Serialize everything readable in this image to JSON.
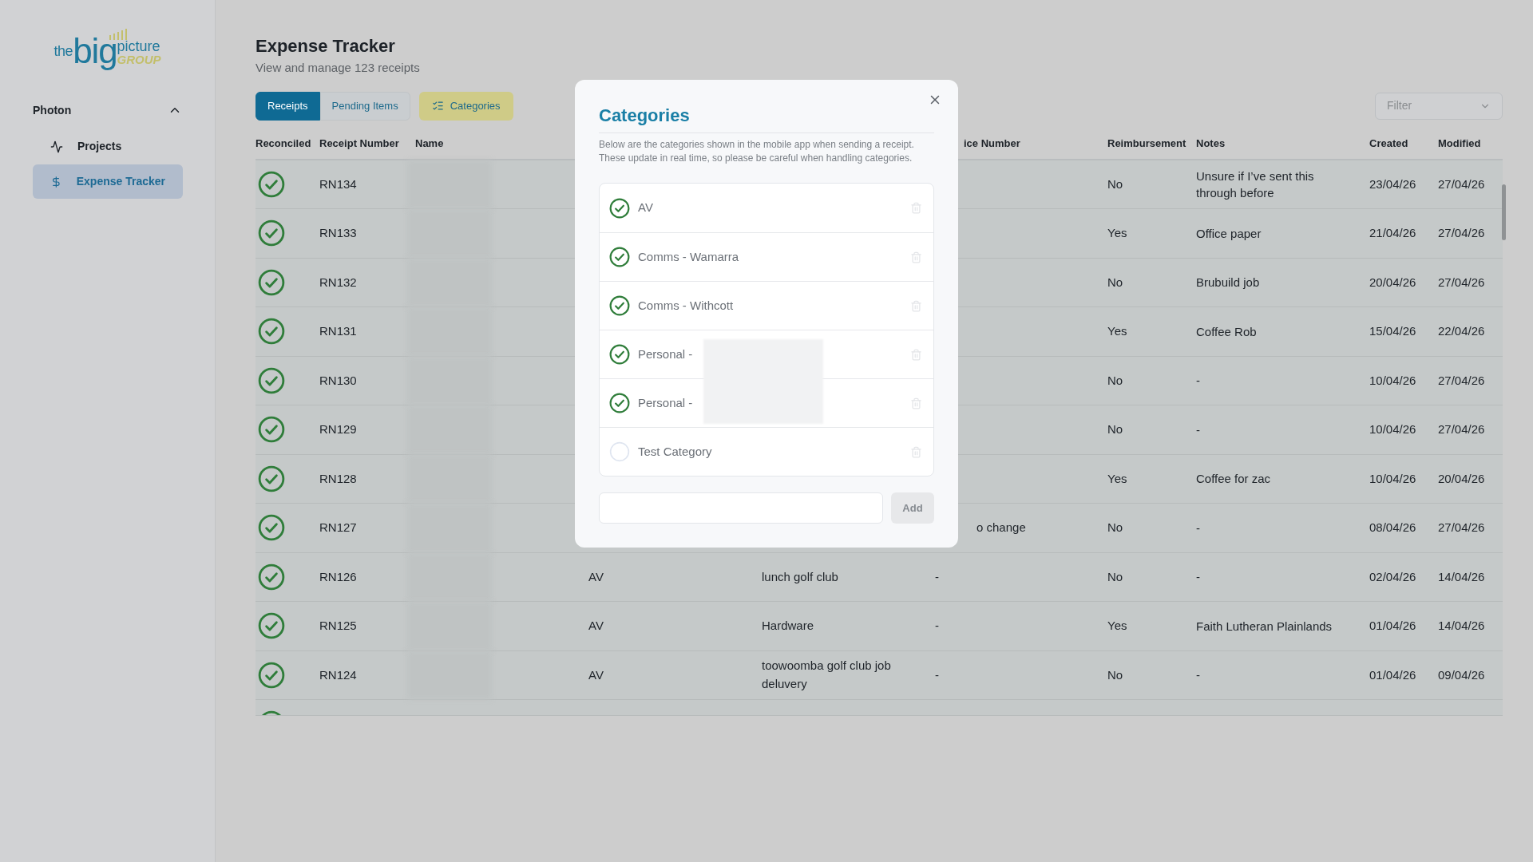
{
  "logo": {
    "word_1": "the",
    "word_2": "big",
    "word_3": "picture",
    "word_4": "GROUP"
  },
  "sidebar": {
    "section": {
      "label": "Photon",
      "expanded": true
    },
    "items": [
      {
        "label": "Projects",
        "kind": "activity",
        "selected": false
      },
      {
        "label": "Expense Tracker",
        "kind": "dollar",
        "selected": true
      }
    ]
  },
  "header": {
    "title": "Expense Tracker",
    "subtitle": "View and manage 123 receipts"
  },
  "tabs": [
    {
      "label": "Receipts",
      "selected": true
    },
    {
      "label": "Pending Items",
      "selected": false
    }
  ],
  "categories_button": {
    "label": "Categories",
    "active": true
  },
  "filter": {
    "placeholder": "Filter"
  },
  "table": {
    "columns": [
      "Reconciled",
      "Receipt Number",
      "Name",
      "ice Number",
      "Reimbursement",
      "Notes",
      "Created",
      "Modified"
    ],
    "rows": [
      {
        "reconciled": true,
        "receipt_number": "RN134",
        "reimbursement": "No",
        "notes": "Unsure if I’ve sent this through before",
        "created": "23/04/26",
        "modified": "27/04/26"
      },
      {
        "reconciled": true,
        "receipt_number": "RN133",
        "reimbursement": "Yes",
        "notes": "Office paper",
        "created": "21/04/26",
        "modified": "27/04/26"
      },
      {
        "reconciled": true,
        "receipt_number": "RN132",
        "reimbursement": "No",
        "notes": "Brubuild job",
        "created": "20/04/26",
        "modified": "27/04/26"
      },
      {
        "reconciled": true,
        "receipt_number": "RN131",
        "reimbursement": "Yes",
        "notes": "Coffee Rob",
        "created": "15/04/26",
        "modified": "22/04/26"
      },
      {
        "reconciled": true,
        "receipt_number": "RN130",
        "reimbursement": "No",
        "notes": "-",
        "created": "10/04/26",
        "modified": "27/04/26"
      },
      {
        "reconciled": true,
        "receipt_number": "RN129",
        "reimbursement": "No",
        "notes": "-",
        "created": "10/04/26",
        "modified": "27/04/26"
      },
      {
        "reconciled": true,
        "receipt_number": "RN128",
        "reimbursement": "Yes",
        "notes": "Coffee for zac",
        "created": "10/04/26",
        "modified": "20/04/26"
      },
      {
        "reconciled": true,
        "receipt_number": "RN127",
        "invoice_number": "o change",
        "reimbursement": "No",
        "notes": "-",
        "created": "08/04/26",
        "modified": "27/04/26"
      },
      {
        "reconciled": true,
        "receipt_number": "RN126",
        "category": "AV",
        "description": "lunch golf club",
        "invoice_number": "-",
        "reimbursement": "No",
        "notes": "-",
        "created": "02/04/26",
        "modified": "14/04/26"
      },
      {
        "reconciled": true,
        "receipt_number": "RN125",
        "category": "AV",
        "description": "Hardware",
        "invoice_number": "-",
        "reimbursement": "Yes",
        "notes": "Faith Lutheran Plainlands",
        "created": "01/04/26",
        "modified": "14/04/26"
      },
      {
        "reconciled": true,
        "receipt_number": "RN124",
        "category": "AV",
        "description": "toowoomba golf club job deluvery",
        "invoice_number": "-",
        "reimbursement": "No",
        "notes": "-",
        "created": "01/04/26",
        "modified": "09/04/26"
      },
      {
        "reconciled": true
      }
    ]
  },
  "dialog": {
    "title": "Categories",
    "description": "Below are the categories shown in the mobile app when sending a receipt. These update in real time, so please be careful when handling categories.",
    "categories": [
      {
        "label": "AV",
        "enabled": true
      },
      {
        "label": "Comms - Wamarra",
        "enabled": true
      },
      {
        "label": "Comms - Withcott",
        "enabled": true
      },
      {
        "label": "Personal -",
        "enabled": true
      },
      {
        "label": "Personal -",
        "enabled": true
      },
      {
        "label": "Test Category",
        "enabled": false
      }
    ],
    "add_button": "Add"
  }
}
